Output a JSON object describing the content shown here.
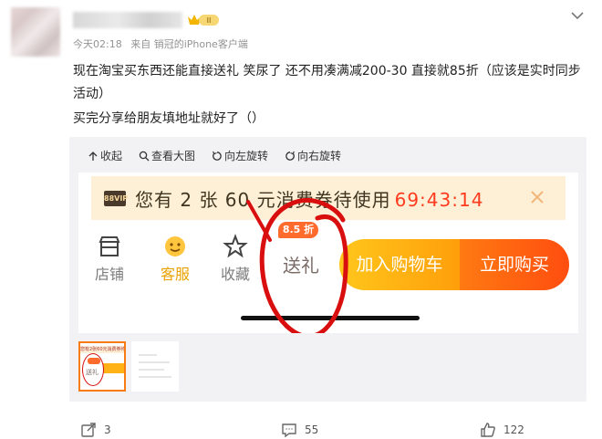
{
  "post": {
    "meta_time": "今天02:18",
    "meta_source": "来自 销冠的iPhone客户端",
    "text_line1": "现在淘宝买东西还能直接送礼 笑尿了 还不用凑满减200-30 直接就85折（应该是实时同步活动）",
    "text_line2": "买完分享给朋友填地址就好了（）",
    "vip_badge_label": "II"
  },
  "viewer": {
    "toolbar": [
      {
        "label": "收起",
        "icon": "collapse-icon"
      },
      {
        "label": "查看大图",
        "icon": "zoom-icon"
      },
      {
        "label": "向左旋转",
        "icon": "rotate-left-icon"
      },
      {
        "label": "向右旋转",
        "icon": "rotate-right-icon"
      }
    ]
  },
  "screenshot": {
    "vip_label": "88VIP",
    "coupon_text": "您有 2 张 60 元消费券待使用",
    "coupon_timer": "69:43:14",
    "shop_label": "店铺",
    "service_label": "客服",
    "favorite_label": "收藏",
    "discount_tag": "8.5 折",
    "gift_label": "送礼",
    "add_cart_label": "加入购物车",
    "buy_now_label": "立即购买",
    "annotation_color": "#d90f0f"
  },
  "thumbnails": {
    "thumb1_coupon": "您有2张60元消费券待使用 69:4",
    "thumb1_gift": "送礼"
  },
  "actions": {
    "share_count": "3",
    "comment_count": "55",
    "like_count": "122"
  },
  "colors": {
    "accent_orange": "#ff6b2d",
    "cart_yellow": "#ffc61c",
    "buy_orange": "#ff4d0f",
    "timer_red": "#ff3b1f"
  }
}
